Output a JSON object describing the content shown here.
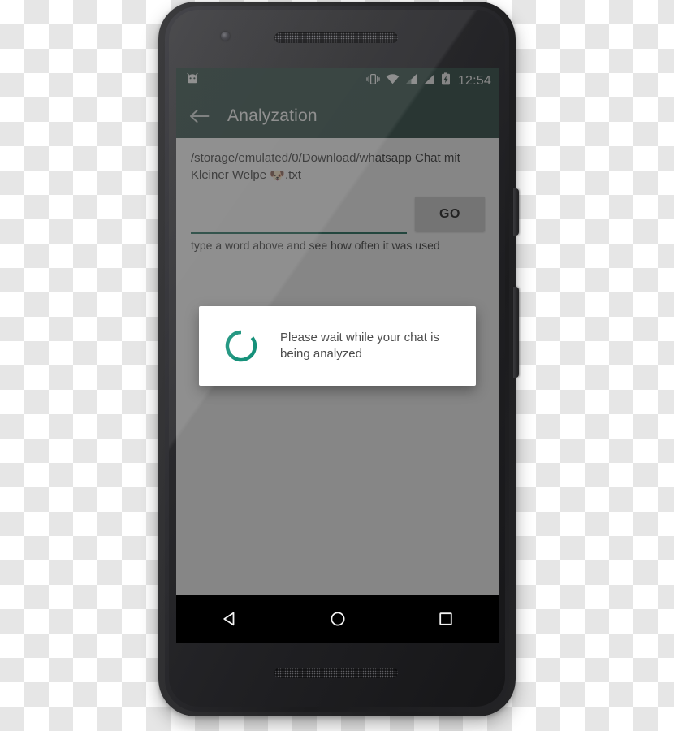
{
  "device": {
    "frame_color": "#262628",
    "camera": "front-camera",
    "earpiece": "earpiece-speaker",
    "bottom_speaker": "bottom-speaker",
    "power_button": "power-button",
    "volume_button": "volume-rocker"
  },
  "status_bar": {
    "background": "#2d4a42",
    "notification_icon": "android-head-icon",
    "icons": [
      "vibrate-icon",
      "wifi-icon",
      "signal-icon",
      "signal-icon",
      "battery-charging-icon"
    ],
    "time": "12:54"
  },
  "app_bar": {
    "background": "#2d4a42",
    "back_icon": "back-arrow-icon",
    "title": "Analyzation"
  },
  "main": {
    "file_path_prefix": "/storage/emulated/0/Download/whatsapp Chat mit Kleiner Welpe ",
    "file_path_emoji": "🐶",
    "file_path_suffix": ".txt",
    "word_input_value": "",
    "word_input_placeholder": "",
    "go_label": "GO",
    "hint": "type a word above and see how often it was used",
    "accent_color": "#1f6f5c"
  },
  "dialog": {
    "spinner": "loading-spinner",
    "spinner_color": "#16917a",
    "message": "Please wait while your chat is being analyzed"
  },
  "nav_bar": {
    "back": "nav-back-icon",
    "home": "nav-home-icon",
    "recents": "nav-recents-icon"
  }
}
